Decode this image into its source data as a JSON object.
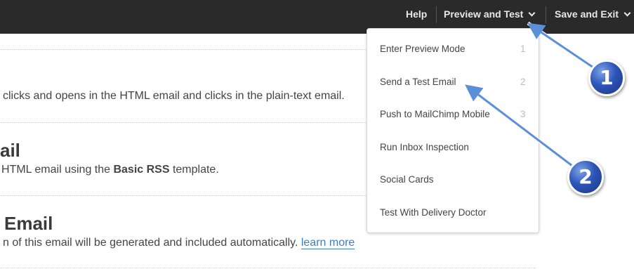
{
  "topbar": {
    "help_label": "Help",
    "preview_label": "Preview and Test",
    "save_label": "Save and Exit"
  },
  "content": {
    "line1": "clicks and opens in the HTML email and clicks in the plain-text email.",
    "heading2": "ail",
    "line2_prefix": "HTML email using the ",
    "line2_bold": "Basic RSS",
    "line2_suffix": " template.",
    "heading3": "Email",
    "line3_prefix": "n of this email will be generated and included automatically. ",
    "line3_link": "learn more"
  },
  "dropdown": {
    "items": [
      {
        "label": "Enter Preview Mode",
        "number": "1"
      },
      {
        "label": "Send a Test Email",
        "number": "2"
      },
      {
        "label": "Push to MailChimp Mobile",
        "number": "3"
      },
      {
        "label": "Run Inbox Inspection",
        "number": ""
      },
      {
        "label": "Social Cards",
        "number": ""
      },
      {
        "label": "Test With Delivery Doctor",
        "number": ""
      }
    ]
  },
  "annotations": {
    "badge1": "1",
    "badge2": "2",
    "color": "#5b8fd8"
  }
}
